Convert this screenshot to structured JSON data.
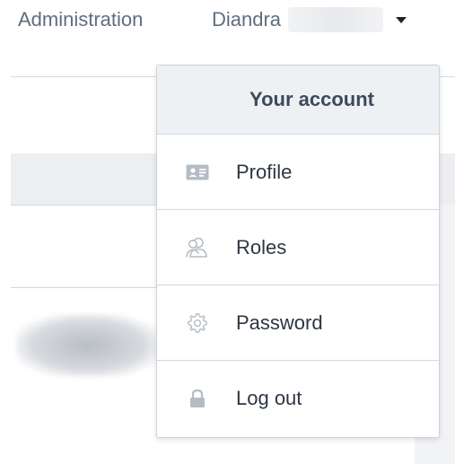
{
  "topnav": {
    "admin_label": "Administration",
    "user_name": "Diandra"
  },
  "account_menu": {
    "header": "Your account",
    "items": [
      {
        "label": "Profile",
        "icon": "id-card-icon"
      },
      {
        "label": "Roles",
        "icon": "user-roles-icon"
      },
      {
        "label": "Password",
        "icon": "gear-icon"
      },
      {
        "label": "Log out",
        "icon": "lock-icon"
      }
    ]
  },
  "colors": {
    "nav_text": "#5e6e80",
    "menu_header_bg": "#eef1f4",
    "icon_gray": "#b6bcc4"
  }
}
